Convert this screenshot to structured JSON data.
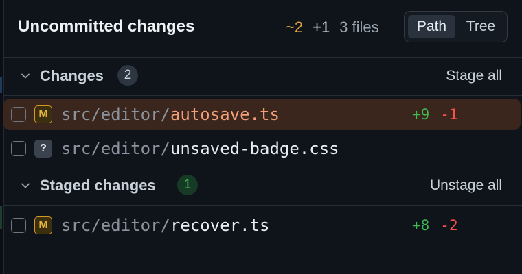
{
  "header": {
    "title": "Uncommitted changes",
    "stats": {
      "modified": "~2",
      "added": "+1",
      "files": "3 files"
    },
    "view_toggle": {
      "options": [
        "Path",
        "Tree"
      ],
      "selected": "Path"
    }
  },
  "sections": {
    "changes": {
      "title": "Changes",
      "count": "2",
      "action": "Stage all",
      "files": [
        {
          "status": "M",
          "dir": "src/editor/",
          "name": "autosave.ts",
          "additions": "+9",
          "deletions": "-1",
          "active": true
        },
        {
          "status": "?",
          "dir": "src/editor/",
          "name": "unsaved-badge.css",
          "additions": "",
          "deletions": "",
          "active": false
        }
      ]
    },
    "staged": {
      "title": "Staged changes",
      "count": "1",
      "action": "Unstage all",
      "files": [
        {
          "status": "M",
          "dir": "src/editor/",
          "name": "recover.ts",
          "additions": "+8",
          "deletions": "-2",
          "active": false
        }
      ]
    }
  },
  "colors": {
    "background": "#0f141b",
    "active_row": "#3a261d",
    "modified": "#e3a23a",
    "addition": "#3fb950",
    "deletion": "#f85149"
  },
  "icons": {
    "section_toggle": "chevron-down-icon",
    "modified_status": "modified-status-icon",
    "untracked_status": "untracked-status-icon"
  }
}
